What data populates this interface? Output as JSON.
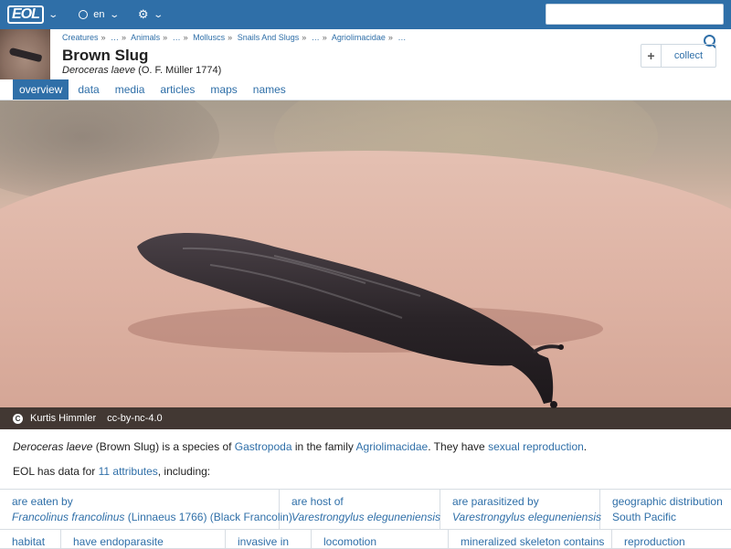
{
  "topbar": {
    "logo": "EOL",
    "language": "en",
    "colors": {
      "bar": "#2f6fa8"
    }
  },
  "taxon": {
    "breadcrumbs": [
      "Creatures",
      "…",
      "Animals",
      "…",
      "Molluscs",
      "Snails And Slugs",
      "…",
      "Agriolimacidae",
      "…"
    ],
    "common_name": "Brown Slug",
    "scientific_name": "Deroceras laeve",
    "authority": "(O. F. Müller 1774)",
    "collect_label": "collect",
    "collect_plus": "+"
  },
  "tabs": [
    {
      "label": "overview",
      "active": true
    },
    {
      "label": "data",
      "active": false
    },
    {
      "label": "media",
      "active": false
    },
    {
      "label": "articles",
      "active": false
    },
    {
      "label": "maps",
      "active": false
    },
    {
      "label": "names",
      "active": false
    }
  ],
  "image": {
    "cc_symbol": "C",
    "author": "Kurtis Himmler",
    "license": "cc-by-nc-4.0"
  },
  "summary": {
    "species": "Deroceras laeve",
    "common": "(Brown Slug) is a species of ",
    "group": "Gastropoda",
    "mid": " in the family ",
    "family": "Agriolimacidae",
    "mid2": ". They have ",
    "trait": "sexual reproduction",
    "end": ".",
    "data_prefix": "EOL has data for ",
    "data_link": "11 attributes",
    "data_suffix": ", including:"
  },
  "attributes": [
    {
      "predicate": "are eaten by",
      "value_sci": "Francolinus francolinus",
      "value_rest": " (Linnaeus 1766) (Black Francolin)"
    },
    {
      "predicate": "are host of",
      "value_sci": "Varestrongylus eleguneniensis",
      "value_rest": ""
    },
    {
      "predicate": "are parasitized by",
      "value_sci": "Varestrongylus eleguneniensis",
      "value_rest": ""
    },
    {
      "predicate": "geographic distribution",
      "value_sci": "",
      "value_rest": "South Pacific"
    },
    {
      "predicate": "habitat"
    },
    {
      "predicate": "have endoparasite"
    },
    {
      "predicate": "invasive in"
    },
    {
      "predicate": "locomotion"
    },
    {
      "predicate": "mineralized skeleton contains"
    },
    {
      "predicate": "reproduction"
    }
  ]
}
